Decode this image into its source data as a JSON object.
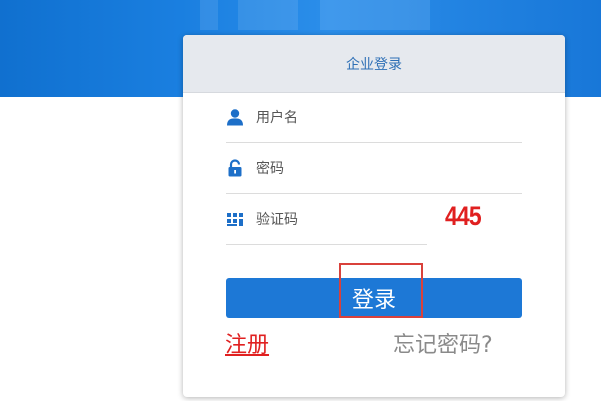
{
  "login_card": {
    "title": "企业登录",
    "username": {
      "placeholder": "用户名",
      "icon": "user-icon"
    },
    "password": {
      "placeholder": "密码",
      "icon": "lock-icon"
    },
    "captcha": {
      "placeholder": "验证码",
      "icon": "captcha-grid-icon",
      "code": "445"
    },
    "login_label": "登录",
    "register_label": "注册",
    "forgot_label": "忘记密码?"
  },
  "colors": {
    "banner": "#1a7fe0",
    "primary_button": "#1d78d6",
    "header_bg": "#e6e9ee",
    "title_text": "#2d6fb6",
    "captcha_text": "#e02020",
    "register_text": "#e02020",
    "forgot_text": "#8a8a8a",
    "highlight_box": "#d9413b"
  }
}
